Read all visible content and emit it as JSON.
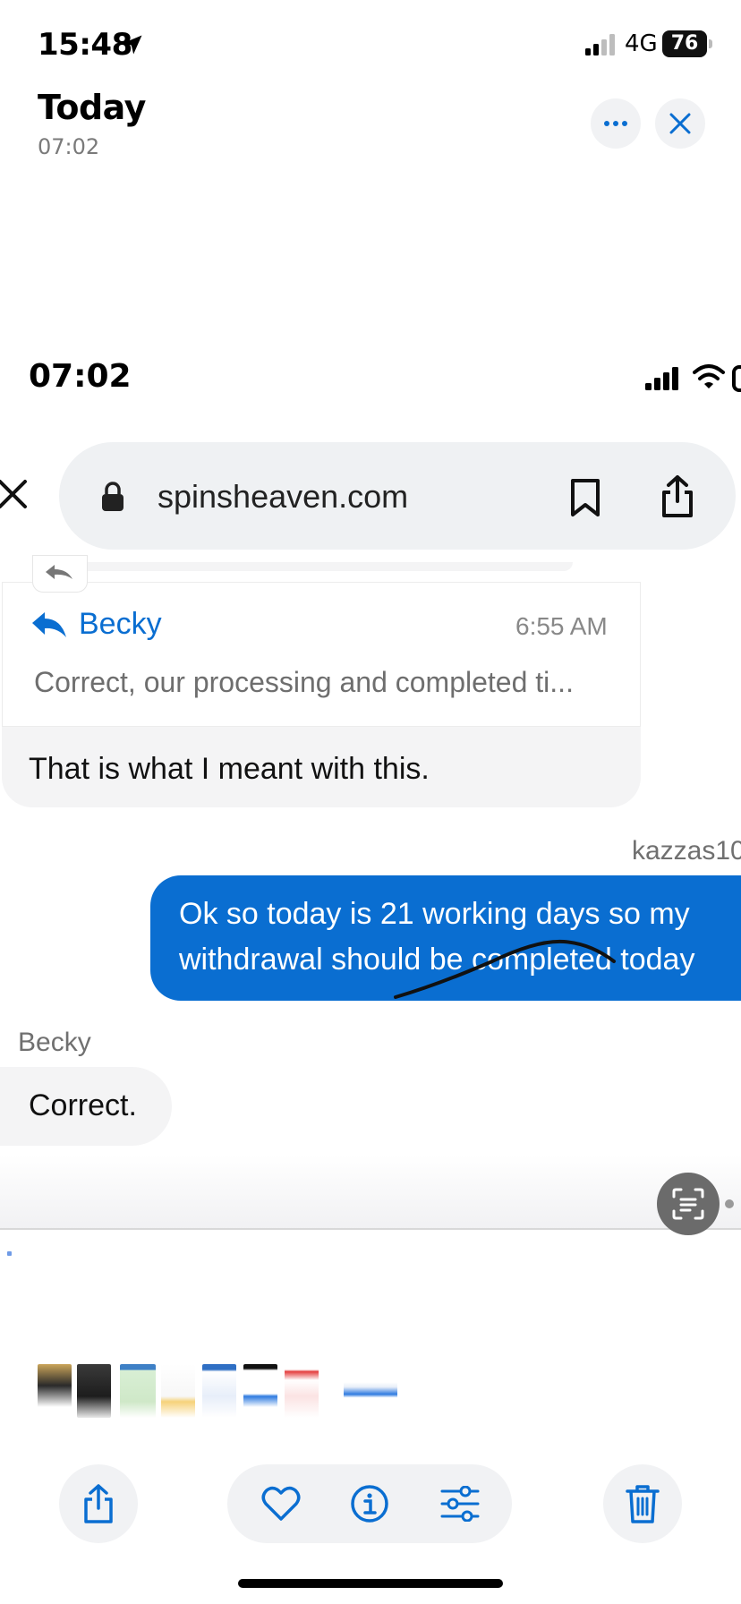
{
  "status_bar": {
    "time": "15:48",
    "network": "4G",
    "battery": "76"
  },
  "header": {
    "title": "Today",
    "subtitle": "07:02"
  },
  "screenshot": {
    "status_time": "07:02",
    "browser": {
      "url": "spinsheaven.com"
    },
    "quoted_message": {
      "name": "Becky",
      "time": "6:55 AM",
      "text": "Correct, our processing and completed ti...",
      "reply": "That is what I meant with this."
    },
    "outgoing": {
      "sender": "kazzas10",
      "text": "Ok so today is 21 working days so my withdrawal should be completed today"
    },
    "incoming": {
      "sender": "Becky",
      "text": "Correct."
    }
  },
  "icons": {
    "more": "ellipsis-icon",
    "close": "close-icon",
    "share": "share-icon",
    "favorite": "heart-icon",
    "info": "info-icon",
    "adjust": "sliders-icon",
    "delete": "trash-icon"
  },
  "colors": {
    "accent": "#0a6ed1",
    "button_bg": "#f1f2f4"
  }
}
